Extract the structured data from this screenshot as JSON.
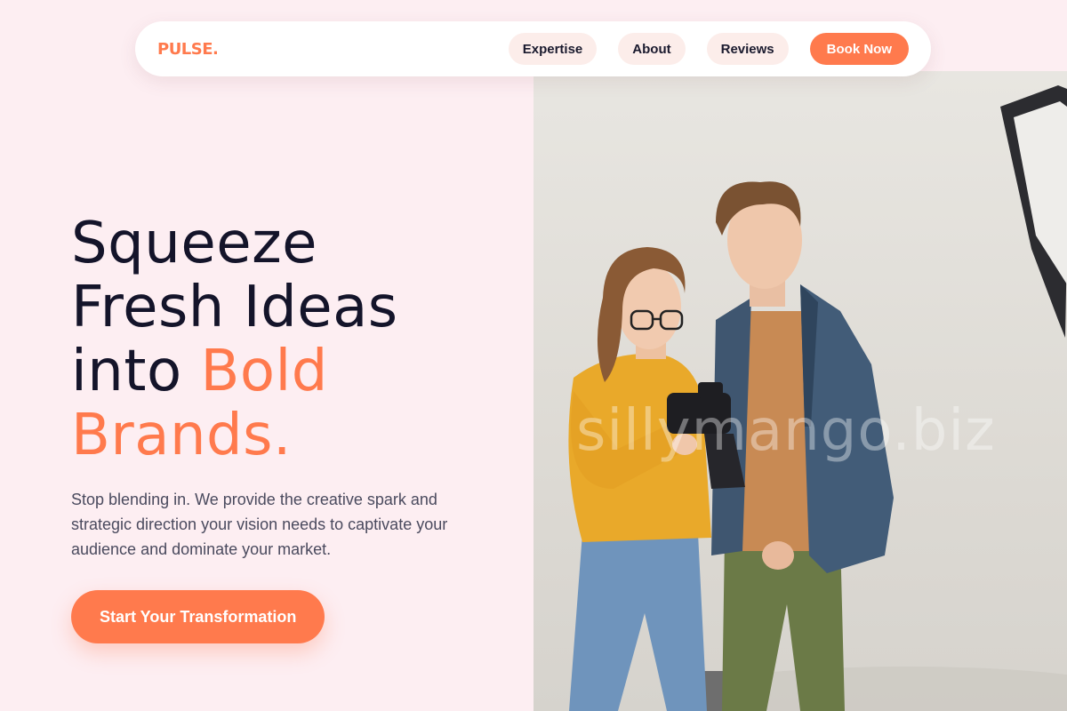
{
  "brand": {
    "logo": "PULSE.",
    "accent": "#FF7A4D",
    "dark": "#14142A"
  },
  "nav": {
    "items": [
      {
        "label": "Expertise"
      },
      {
        "label": "About"
      },
      {
        "label": "Reviews"
      }
    ],
    "cta_label": "Book Now"
  },
  "hero": {
    "title_line_1": "Squeeze",
    "title_line_2": "Fresh Ideas",
    "title_line_3_plain": "into ",
    "title_line_3_accent": "Bold",
    "title_line_4_accent": "Brands.",
    "subtitle": "Stop blending in. We provide the creative spark and strategic direction your vision needs to captivate your audience and dominate your market.",
    "cta_label": "Start Your Transformation"
  },
  "image": {
    "watermark": "sillymango.biz"
  }
}
